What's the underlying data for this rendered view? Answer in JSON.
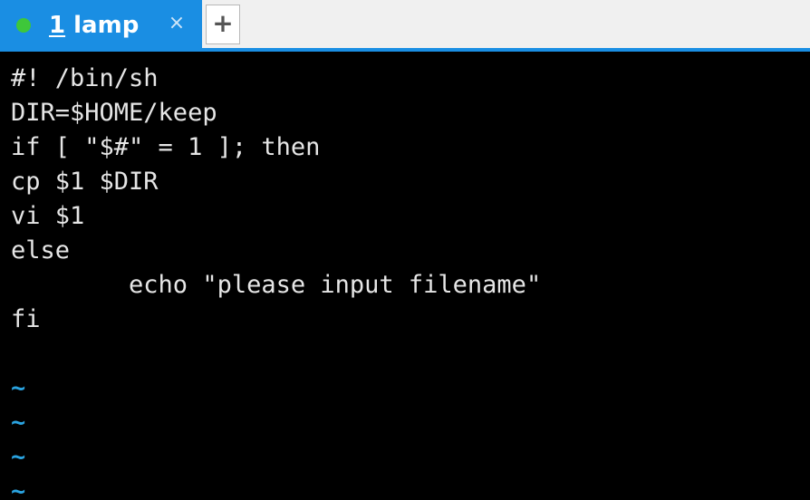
{
  "tabs": [
    {
      "number": "1",
      "title": " lamp",
      "status_color": "#3ec73a",
      "close_glyph": "×",
      "active": true
    }
  ],
  "new_tab_glyph": "+",
  "colors": {
    "accent": "#1a8ee3",
    "terminal_bg": "#000000",
    "terminal_fg": "#e6e6e6",
    "tilde": "#2aa3e0"
  },
  "editor": {
    "lines": [
      "#! /bin/sh",
      "DIR=$HOME/keep",
      "if [ \"$#\" = 1 ]; then",
      "cp $1 $DIR",
      "vi $1",
      "else",
      "        echo \"please input filename\"",
      "fi",
      ""
    ],
    "empty_markers": [
      "~",
      "~",
      "~",
      "~"
    ]
  }
}
